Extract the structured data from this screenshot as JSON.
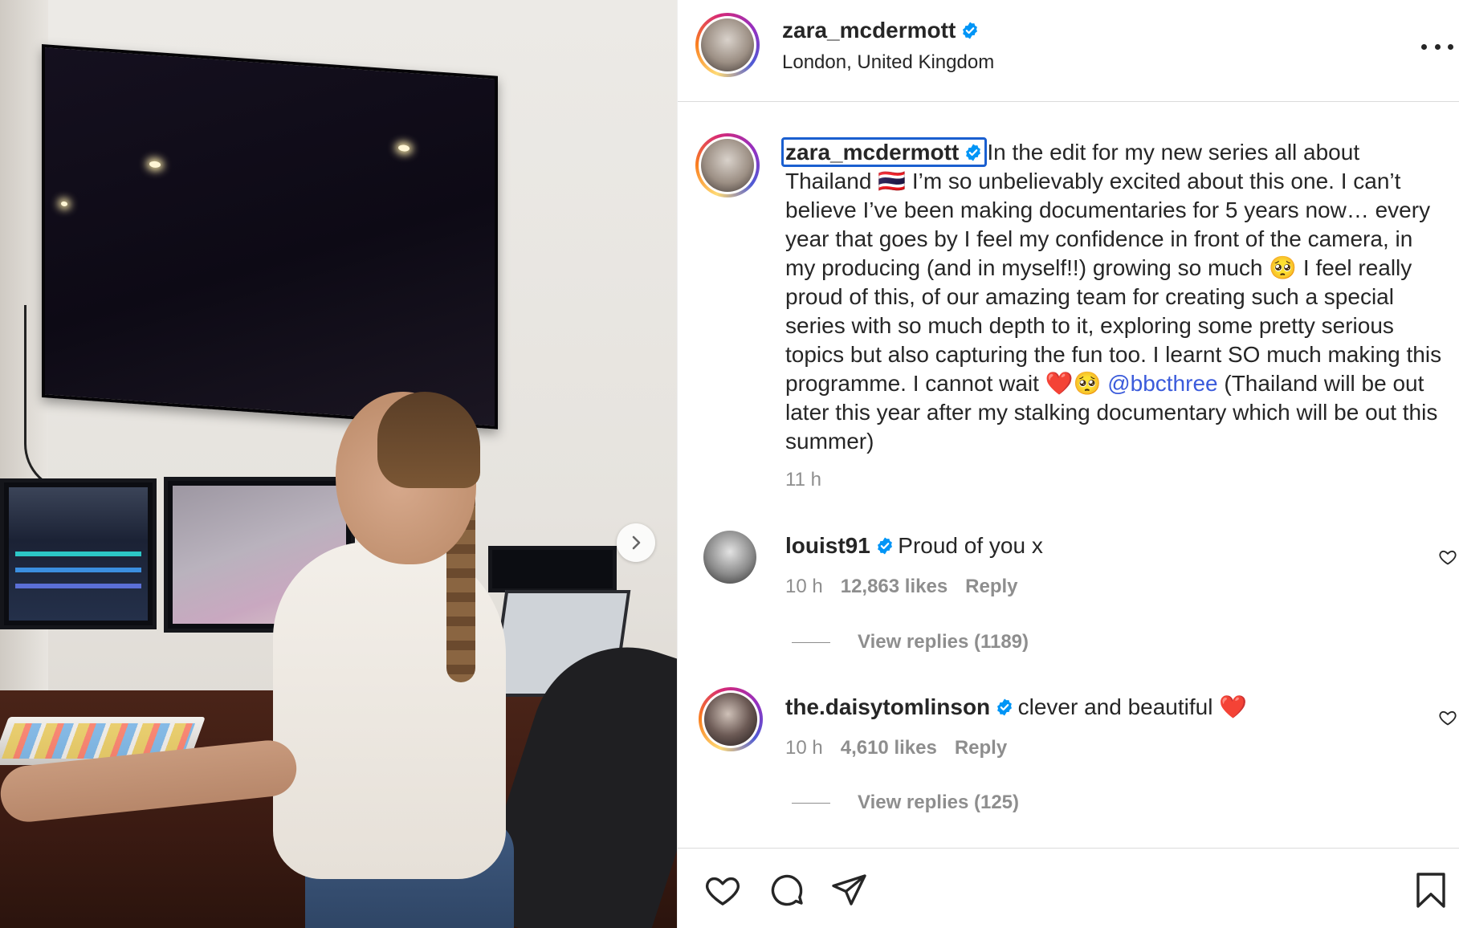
{
  "post": {
    "author": "zara_mcdermott",
    "location": "London, United Kingdom",
    "caption_user": "zara_mcdermott",
    "caption_text": "In the edit for my new series all about Thailand 🇹🇭 I’m so unbelievably excited about this one. I can’t believe I’ve been making documentaries for 5 years now… every year that goes by I feel my confidence in front of the camera, in my producing (and in myself!!) growing so much 🥺 I feel really proud of this, of our amazing team for creating such a special series with so much depth to it, exploring some pretty serious topics but also capturing the fun too. I learnt SO much making this programme. I cannot wait ❤️🥺",
    "caption_mention": "@bbcthree",
    "caption_tail": "(Thailand will be out later this year after my stalking documentary which will be out this summer)",
    "time": "11 h"
  },
  "comments": [
    {
      "user": "louist91",
      "text": "Proud of you x",
      "time": "10 h",
      "likes": "12,863 likes",
      "reply": "Reply",
      "view_replies": "View replies (1189)"
    },
    {
      "user": "the.daisytomlinson",
      "text": "clever and beautiful ❤️",
      "time": "10 h",
      "likes": "4,610 likes",
      "reply": "Reply",
      "view_replies": "View replies (125)"
    }
  ],
  "icons": {
    "verified": "verified-badge-icon",
    "more": "more-options-icon",
    "next": "chevron-right-icon",
    "like": "heart-icon",
    "comment": "comment-icon",
    "share": "share-icon",
    "save": "bookmark-icon"
  },
  "colors": {
    "verified": "#0095f6",
    "mention": "#3b5bdb",
    "muted": "#8e8e8e",
    "focus_outline": "#1a5fd0"
  }
}
